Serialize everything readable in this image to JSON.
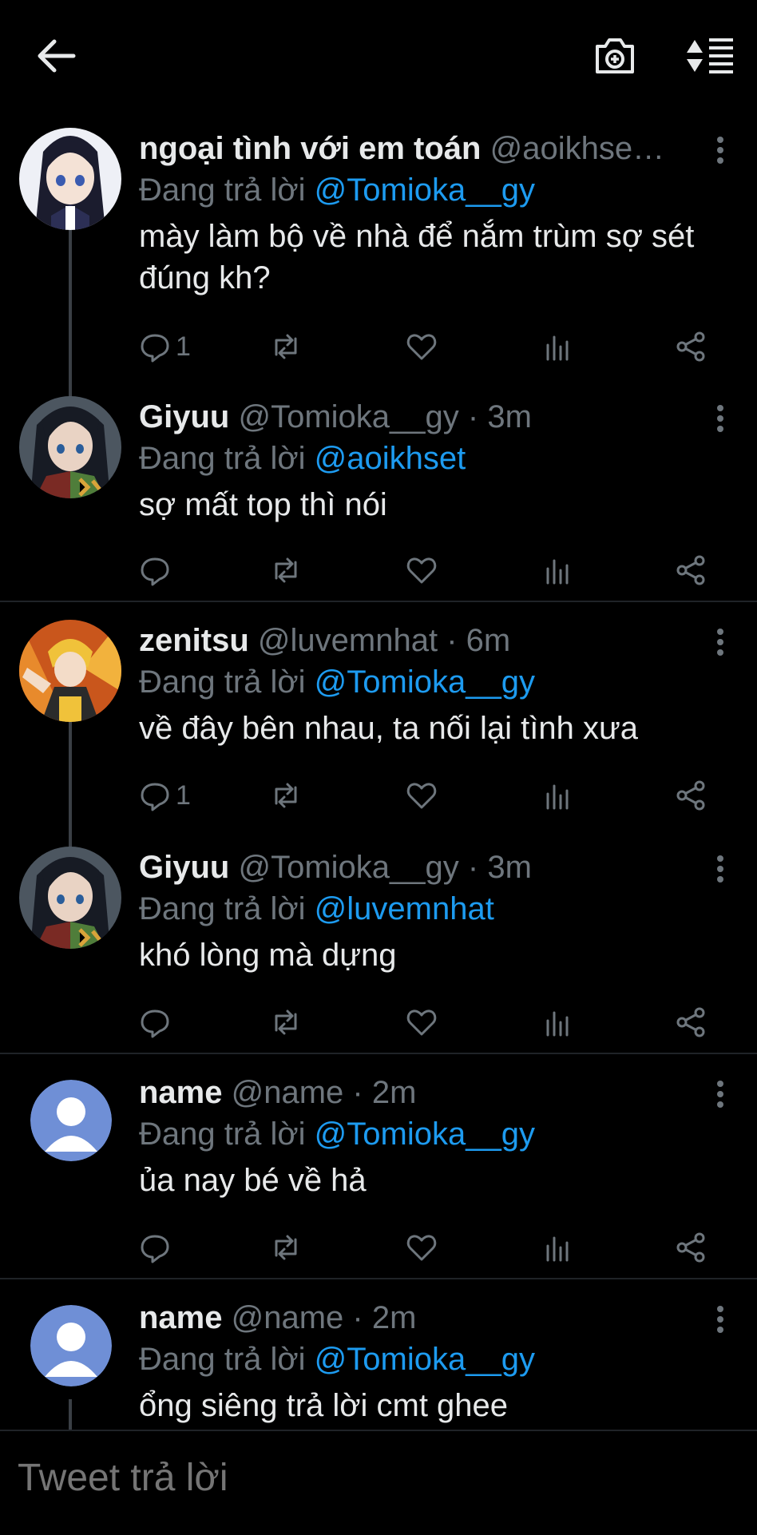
{
  "composer": {
    "placeholder": "Tweet trả lời"
  },
  "reply_prefix": "Đang trả lời",
  "tweets": [
    {
      "name": "ngoại tình với em toán",
      "handle": "@aoikhse…",
      "time": "",
      "replying_to": "@Tomioka__gy",
      "text": "mày làm bộ về nhà để nắm trùm sợ sét đúng kh?",
      "reply_count": "1",
      "avatar": "anime-girl-avatar"
    },
    {
      "name": "Giyuu",
      "handle": "@Tomioka__gy",
      "time": "· 3m",
      "replying_to": "@aoikhset",
      "text": "sợ mất top thì nói",
      "reply_count": "",
      "avatar": "giyuu-avatar"
    },
    {
      "name": "zenitsu",
      "handle": "@luvemnhat",
      "time": "· 6m",
      "replying_to": "@Tomioka__gy",
      "text": "về đây bên nhau, ta nối lại tình xưa",
      "reply_count": "1",
      "avatar": "zenitsu-avatar"
    },
    {
      "name": "Giyuu",
      "handle": "@Tomioka__gy",
      "time": "· 3m",
      "replying_to": "@luvemnhat",
      "text": "khó lòng mà dựng",
      "reply_count": "",
      "avatar": "giyuu-avatar"
    },
    {
      "name": "name",
      "handle": "@name",
      "time": "· 2m",
      "replying_to": "@Tomioka__gy",
      "text": "ủa nay bé về hả",
      "reply_count": "",
      "avatar": "default-avatar"
    },
    {
      "name": "name",
      "handle": "@name",
      "time": "· 2m",
      "replying_to": "@Tomioka__gy",
      "text": "ổng siêng trả lời cmt ghee",
      "reply_count": "",
      "avatar": "default-avatar"
    }
  ],
  "colors": {
    "background": "#000000",
    "text": "#e7e9ea",
    "muted": "#6e767d",
    "accent": "#1d9bf0",
    "divider": "#1f2327"
  },
  "icons": [
    "back-arrow-icon",
    "camera-plus-icon",
    "sort-icon",
    "reply-icon",
    "retweet-icon",
    "like-icon",
    "analytics-icon",
    "share-icon",
    "more-icon"
  ]
}
